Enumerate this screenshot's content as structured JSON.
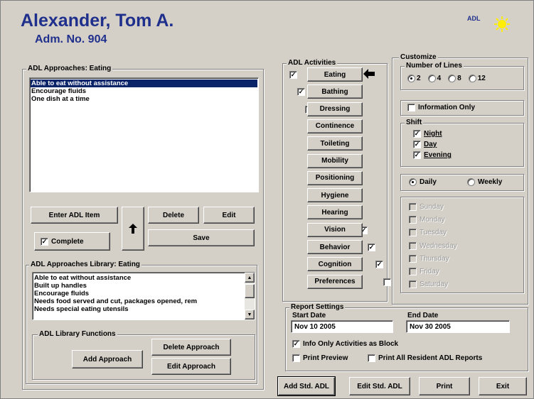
{
  "header": {
    "name": "Alexander, Tom A.",
    "adm": "Adm. No. 904",
    "badge": "ADL"
  },
  "approaches": {
    "label": "ADL Approaches: Eating",
    "items": [
      "Able to eat without assistance",
      "Encourage fluids",
      "One dish at a time"
    ],
    "selected": 0
  },
  "buttons": {
    "enter": "Enter ADL Item",
    "delete": "Delete",
    "edit": "Edit",
    "save": "Save",
    "complete": "Complete",
    "add_approach": "Add Approach",
    "delete_approach": "Delete Approach",
    "edit_approach": "Edit Approach",
    "add_std": "Add Std. ADL",
    "edit_std": "Edit Std. ADL",
    "print": "Print",
    "exit": "Exit"
  },
  "complete_checked": true,
  "library": {
    "label": "ADL Approaches Library: Eating",
    "items": [
      "Able to eat without assistance",
      "Built up handles",
      "Encourage fluids",
      "Needs food served and cut, packages opened, rem",
      "Needs special eating utensils"
    ],
    "functions_label": "ADL Library Functions"
  },
  "activities": {
    "label": "ADL Activities",
    "items": [
      {
        "name": "Eating",
        "checked": true
      },
      {
        "name": "Bathing",
        "checked": true
      },
      {
        "name": "Dressing",
        "checked": true
      },
      {
        "name": "Continence",
        "checked": true
      },
      {
        "name": "Toileting",
        "checked": true
      },
      {
        "name": "Mobility",
        "checked": true
      },
      {
        "name": "Positioning",
        "checked": true
      },
      {
        "name": "Hygiene",
        "checked": true
      },
      {
        "name": "Hearing",
        "checked": true
      },
      {
        "name": "Vision",
        "checked": true
      },
      {
        "name": "Behavior",
        "checked": true
      },
      {
        "name": "Cognition",
        "checked": true
      },
      {
        "name": "Preferences",
        "checked": false
      }
    ]
  },
  "customize": {
    "label": "Customize",
    "lines_label": "Number of Lines",
    "lines": [
      "2",
      "4",
      "8",
      "12"
    ],
    "lines_selected": 0,
    "info_only": "Information Only",
    "shift_label": "Shift",
    "shifts": [
      "Night",
      "Day",
      "Evening"
    ],
    "daily": "Daily",
    "weekly": "Weekly",
    "days": [
      "Sunday",
      "Monday",
      "Tuesday",
      "Wednesday",
      "Thursday",
      "Friday",
      "Saturday"
    ]
  },
  "report": {
    "label": "Report Settings",
    "start_label": "Start Date",
    "start": "Nov 10 2005",
    "end_label": "End Date",
    "end": "Nov 30 2005",
    "info_block": "Info Only Activities as Block",
    "print_preview": "Print Preview",
    "print_all": "Print All Resident ADL Reports"
  },
  "colors": {
    "title": "#1f2f8c",
    "selection": "#0a246a",
    "sun": "#ffee00"
  }
}
